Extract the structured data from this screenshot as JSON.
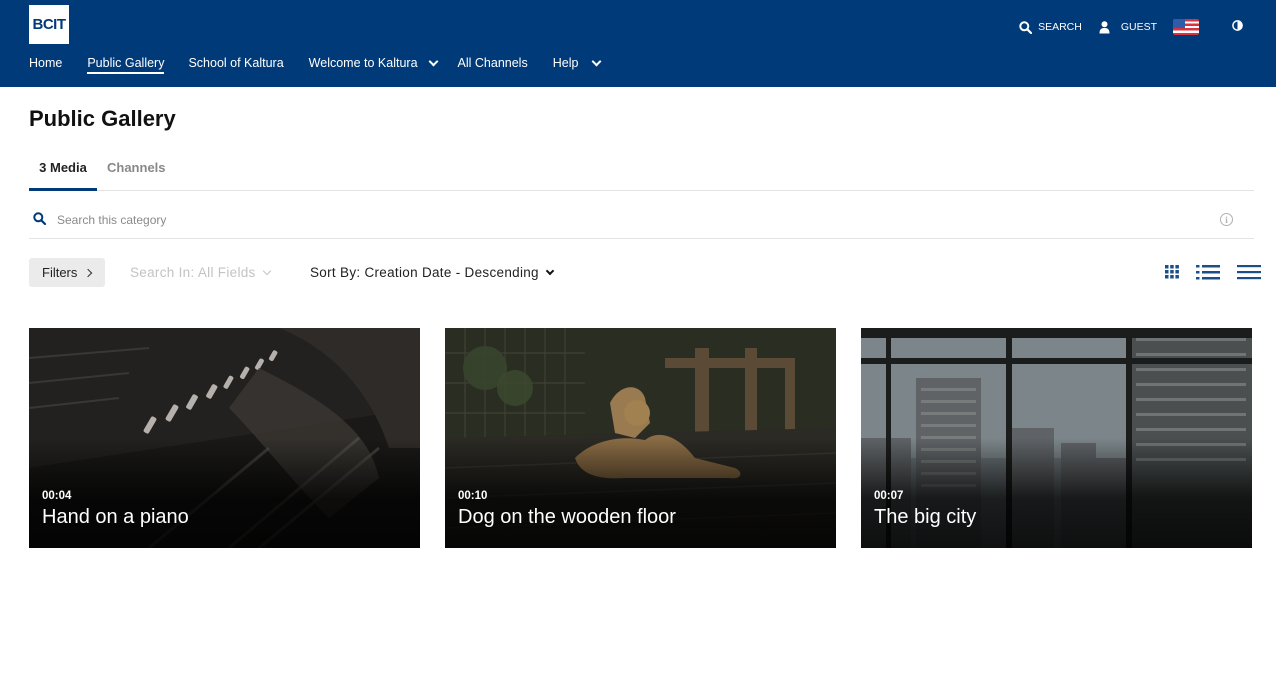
{
  "header": {
    "logo_text": "BCIT",
    "nav": [
      {
        "label": "Home"
      },
      {
        "label": "Public Gallery"
      },
      {
        "label": "School of Kaltura"
      },
      {
        "label": "Welcome to Kaltura"
      },
      {
        "label": "All Channels"
      },
      {
        "label": "Help"
      }
    ],
    "search_label": "SEARCH",
    "user_label": "GUEST",
    "brand_color": "#003a78"
  },
  "page": {
    "title": "Public Gallery",
    "tabs": [
      {
        "label": "3 Media"
      },
      {
        "label": "Channels"
      }
    ],
    "search_placeholder": "Search this category",
    "filters_label": "Filters",
    "search_in_label": "Search In: All Fields",
    "sort_by_label": "Sort By: Creation Date - Descending"
  },
  "media": [
    {
      "duration": "00:04",
      "title": "Hand on a piano"
    },
    {
      "duration": "00:10",
      "title": "Dog on the wooden floor"
    },
    {
      "duration": "00:07",
      "title": "The big city"
    }
  ]
}
